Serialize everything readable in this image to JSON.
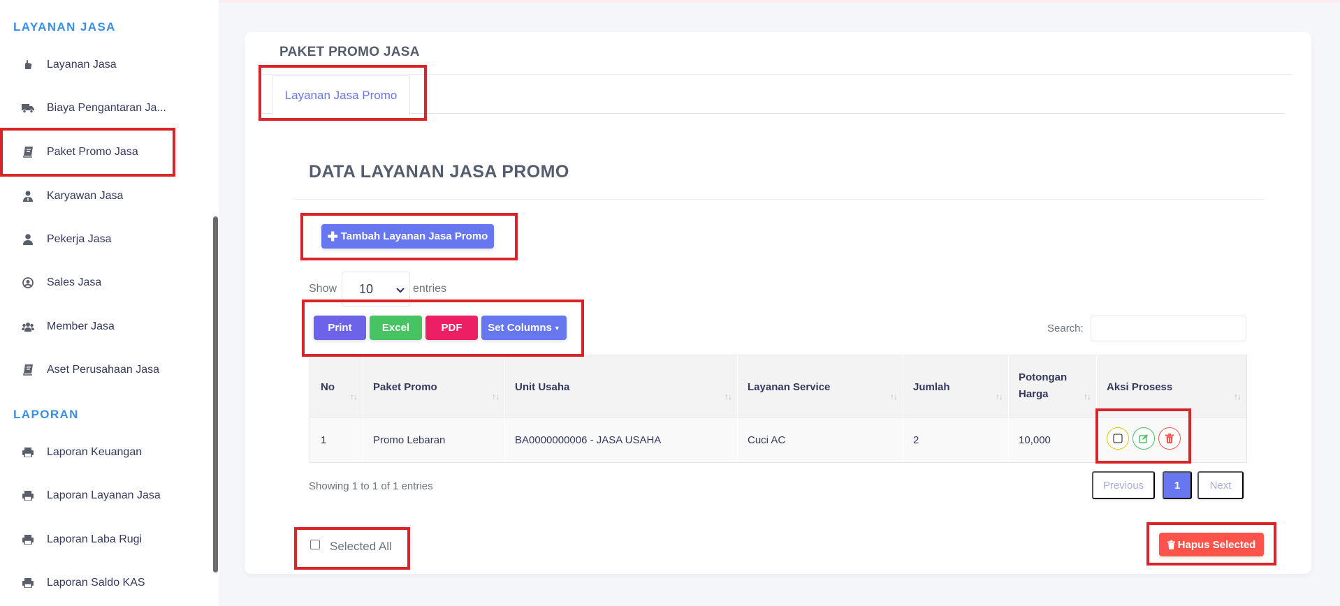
{
  "sidebar": {
    "sections": [
      {
        "header": "LAYANAN JASA"
      },
      {
        "header": "LAPORAN"
      }
    ],
    "items": [
      {
        "label": "Layanan Jasa",
        "icon": "hand-icon"
      },
      {
        "label": "Biaya Pengantaran Ja...",
        "icon": "truck-icon"
      },
      {
        "label": "Paket Promo Jasa",
        "icon": "book-icon"
      },
      {
        "label": "Karyawan Jasa",
        "icon": "user-tie-icon"
      },
      {
        "label": "Pekerja Jasa",
        "icon": "user-icon"
      },
      {
        "label": "Sales Jasa",
        "icon": "user-circle-icon"
      },
      {
        "label": "Member Jasa",
        "icon": "users-icon"
      },
      {
        "label": "Aset Perusahaan Jasa",
        "icon": "book-icon"
      },
      {
        "label": "Laporan Keuangan",
        "icon": "printer-icon"
      },
      {
        "label": "Laporan Layanan Jasa",
        "icon": "printer-icon"
      },
      {
        "label": "Laporan Laba Rugi",
        "icon": "printer-icon"
      },
      {
        "label": "Laporan Saldo KAS",
        "icon": "printer-icon"
      }
    ]
  },
  "card": {
    "title": "PAKET PROMO JASA",
    "tab_label": "Layanan Jasa Promo",
    "section_title": "DATA LAYANAN JASA PROMO"
  },
  "toolbar": {
    "add_label": "Tambah Layanan Jasa Promo",
    "show_label": "Show",
    "entries_value": "10",
    "entries_label": "entries",
    "print_label": "Print",
    "excel_label": "Excel",
    "pdf_label": "PDF",
    "set_columns_label": "Set Columns",
    "search_label": "Search:",
    "search_value": ""
  },
  "table": {
    "columns": [
      "No",
      "Paket Promo",
      "Unit Usaha",
      "Layanan Service",
      "Jumlah",
      "Potongan Harga",
      "Aksi Prosess"
    ],
    "potongan_line1": "Potongan",
    "potongan_line2": "Harga",
    "rows": [
      {
        "no": "1",
        "paket_promo": "Promo Lebaran",
        "unit_usaha": "BA0000000006 - JASA USAHA",
        "layanan_service": "Cuci AC",
        "jumlah": "2",
        "potongan_harga": "10,000"
      }
    ]
  },
  "footer": {
    "showing": "Showing 1 to 1 of 1 entries",
    "prev_label": "Previous",
    "page_1": "1",
    "next_label": "Next",
    "selected_all_label": "Selected All",
    "hapus_label": "Hapus Selected"
  },
  "colors": {
    "primary": "#6777ef",
    "success": "#47c363",
    "danger": "#fc544b",
    "pdf": "#ec1f64",
    "highlight": "#d9252a"
  }
}
